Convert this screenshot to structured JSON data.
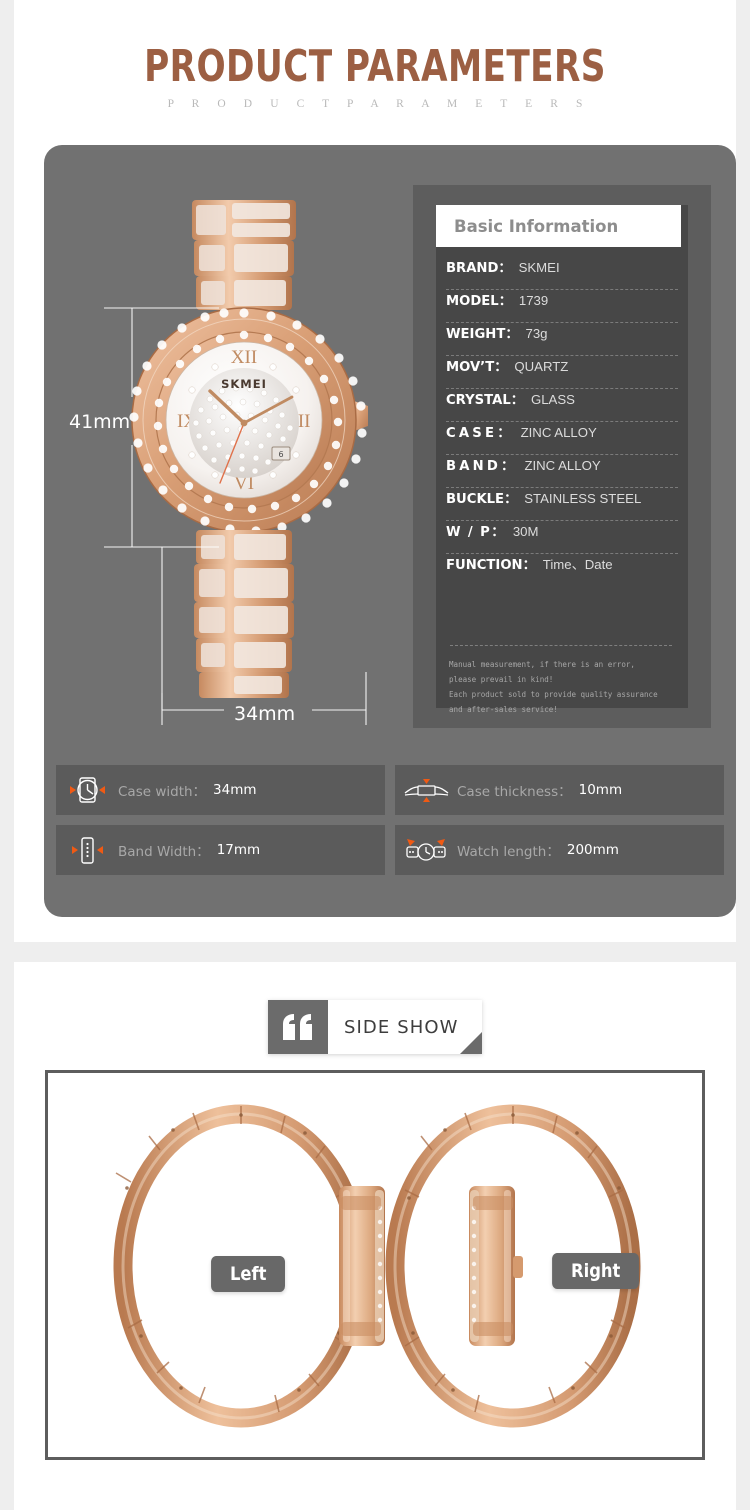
{
  "header": {
    "title": "PRODUCT PARAMETERS",
    "subtitle": "P R O D U C T    P A R A M E T E R S",
    "title_color": "#9c5f43"
  },
  "product_image": {
    "dimension_height": "41mm",
    "dimension_width": "34mm",
    "dial_brand": "SKMEI",
    "numerals": [
      "XII",
      "III",
      "VI",
      "IX"
    ]
  },
  "spec_card": {
    "header": "Basic Information",
    "rows": [
      {
        "key": "BRAND：",
        "value": "SKMEI",
        "spacing": "none"
      },
      {
        "key": "MODEL：",
        "value": "1739",
        "spacing": "none"
      },
      {
        "key": "WEIGHT：",
        "value": "73g",
        "spacing": "none"
      },
      {
        "key": "MOV’T：",
        "value": "QUARTZ",
        "spacing": "none"
      },
      {
        "key": "CRYSTAL：",
        "value": "GLASS",
        "spacing": "none"
      },
      {
        "key": "CASE：",
        "value": "ZINC ALLOY",
        "spacing": "wide"
      },
      {
        "key": "BAND：",
        "value": "ZINC ALLOY",
        "spacing": "wide"
      },
      {
        "key": "BUCKLE：",
        "value": "STAINLESS STEEL",
        "spacing": "none"
      },
      {
        "key": "W / P：",
        "value": "30M",
        "spacing": "mid"
      },
      {
        "key": "FUNCTION：",
        "value": "Time、Date",
        "spacing": "none"
      }
    ],
    "note_line1": "Manual measurement, if there is an error, please prevail in kind!",
    "note_line2": "Each product sold to provide quality assurance and after-sales service!"
  },
  "measurements": [
    {
      "icon": "case-width-icon",
      "label": "Case width：",
      "value": "34mm"
    },
    {
      "icon": "case-thickness-icon",
      "label": "Case thickness：",
      "value": "10mm"
    },
    {
      "icon": "band-width-icon",
      "label": "Band Width：",
      "value": "17mm"
    },
    {
      "icon": "watch-length-icon",
      "label": "Watch length：",
      "value": "200mm"
    }
  ],
  "side_show": {
    "banner_label": "SIDE SHOW",
    "left_label": "Left",
    "right_label": "Right"
  },
  "colors": {
    "panel_gray": "#717171",
    "card_gray": "#5d5d5d",
    "inner_gray": "#474747",
    "tile_gray": "#5b5b5b",
    "arrow_orange": "#f05a14",
    "rose_gold": "#d9a07a"
  }
}
